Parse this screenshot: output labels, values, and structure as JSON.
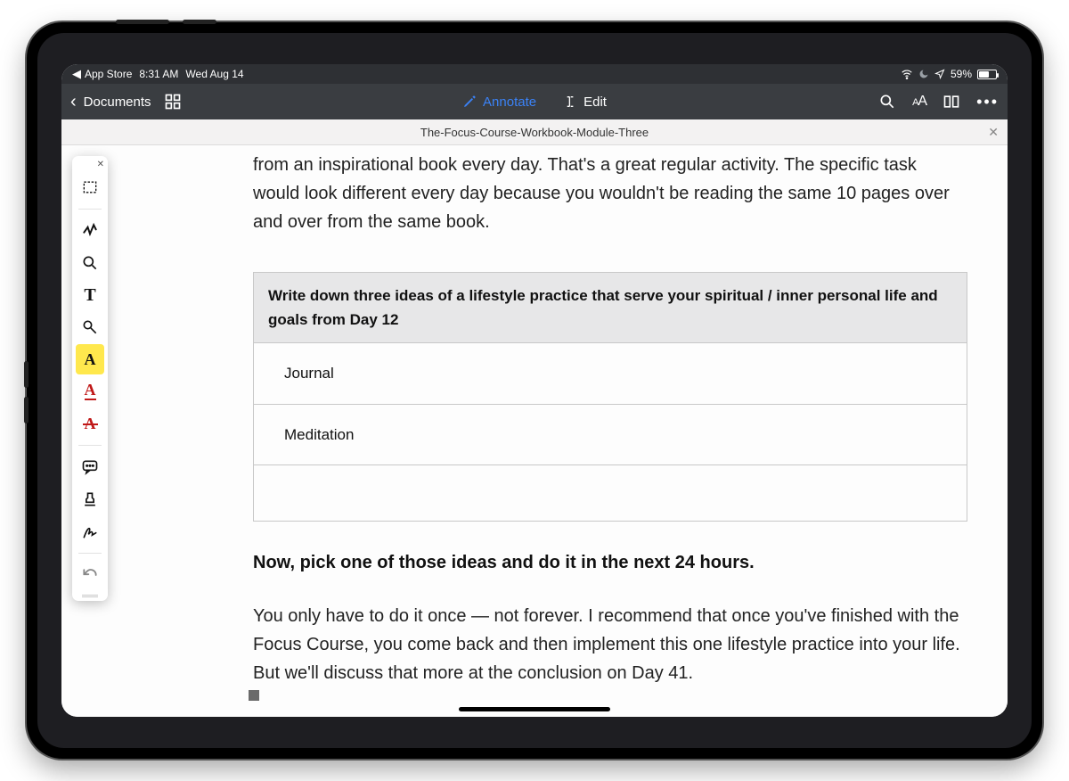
{
  "status": {
    "back_app": "App Store",
    "time": "8:31 AM",
    "date": "Wed Aug 14",
    "battery_pct": "59%",
    "location_glyph": "➤",
    "wifi_glyph": "⌵"
  },
  "navbar": {
    "back_label": "Documents",
    "mode_annotate": "Annotate",
    "mode_edit": "Edit"
  },
  "tab": {
    "title": "The-Focus-Course-Workbook-Module-Three"
  },
  "document": {
    "para_top": "from an inspirational book every day. That's a great regular activity. The specific task would look different every day because you wouldn't be reading the same 10 pages over and over from the same book.",
    "worksheet_header": "Write down three ideas of a lifestyle practice that serve your spiritual / inner personal life and goals from Day 12",
    "rows": [
      "Journal",
      "Meditation",
      ""
    ],
    "pick_line": "Now, pick one of those ideas and do it in the next 24 hours.",
    "para_bottom": "You only have to do it once — not forever. I recommend that once you've finished with the Focus Course, you come back and then implement this one lifestyle practice into your life. But we'll discuss that more at the conclusion on Day 41."
  },
  "palette": {
    "tools": [
      "selection-rect",
      "draw-scribble",
      "magnifier",
      "text-tool",
      "shape-circle-line",
      "highlight-text",
      "underline-text",
      "strikethrough-text",
      "comment-bubble",
      "stamp",
      "signature",
      "undo"
    ]
  }
}
